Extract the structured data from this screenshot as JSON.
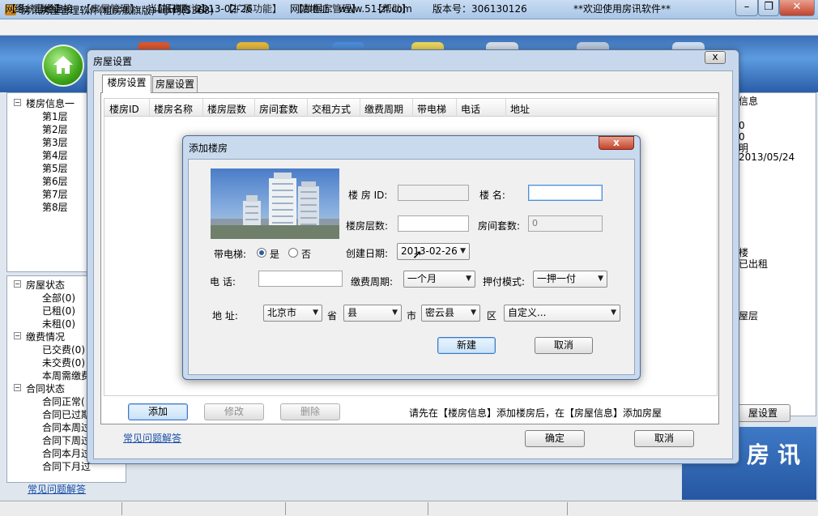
{
  "window": {
    "title": "房讯房屋管理软件(租房舰旗版)--小何(5368)",
    "min": "–",
    "max": "❐",
    "close": "✕"
  },
  "menu": [
    "【系统菜单】",
    "【房屋管理】",
    "【报表查询】",
    "【扩展功能】",
    "【数据库管理】",
    "【帮助】"
  ],
  "left_tree": {
    "root": "楼房信息一",
    "floors": [
      "第1层",
      "第2层",
      "第3层",
      "第4层",
      "第5层",
      "第6层",
      "第7层",
      "第8层"
    ]
  },
  "status_tree": {
    "house_status": "房屋状态",
    "house_items": [
      "全部(0)",
      "已租(0)",
      "未租(0)"
    ],
    "payment": "缴费情况",
    "payment_items": [
      "已交费(0)",
      "未交费(0)",
      "本周需缴费"
    ],
    "contract": "合同状态",
    "contract_items": [
      "合同正常(",
      "合同已过期",
      "合同本周过",
      "合同下周过",
      "合同本月过",
      "合同下月过"
    ]
  },
  "faq_left": "常见问题解答",
  "right_panel": {
    "lines": [
      "信息",
      "0",
      "0",
      "明",
      "2013/05/24",
      "楼",
      "已出租",
      "屋层"
    ],
    "button": "屋设置",
    "brand": "房讯"
  },
  "status_bar": {
    "network": "网络：已经连接",
    "date": "当前日期：2013-02-26",
    "site": "网站地址：www.51-zf.com",
    "version": "版本号：306130126",
    "welcome": "**欢迎使用房讯软件**"
  },
  "house_settings": {
    "title": "房屋设置",
    "close": "x",
    "tabs": [
      "楼房设置",
      "房屋设置"
    ],
    "columns": [
      "楼房ID",
      "楼房名称",
      "楼房层数",
      "房间套数",
      "交租方式",
      "缴费周期",
      "带电梯",
      "电话",
      "地址"
    ],
    "add": "添加",
    "edit": "修改",
    "delete": "删除",
    "hint": "请先在【楼房信息】添加楼房后，在【房屋信息】添加房屋",
    "faq": "常见问题解答",
    "ok": "确定",
    "cancel": "取消"
  },
  "add_building": {
    "title": "添加楼房",
    "close": "x",
    "building_id_label": "楼 房 ID:",
    "building_id": "",
    "name_label": "楼    名:",
    "name": "",
    "floors_label": "楼房层数:",
    "floors": "",
    "rooms_label": "房间套数:",
    "rooms": "0",
    "elevator_label": "带电梯:",
    "elevator_yes": "是",
    "elevator_no": "否",
    "elevator_value": "是",
    "created_label": "创建日期:",
    "created": "2013-02-26",
    "phone_label": "电    话:",
    "phone": "",
    "period_label": "缴费周期:",
    "period": "一个月",
    "payment_label": "押付模式:",
    "payment": "一押一付",
    "address_label": "地    址:",
    "province": "北京市",
    "province_unit": "省",
    "city": "县",
    "city_unit": "市",
    "district": "密云县",
    "district_unit": "区",
    "custom": "自定义...",
    "create": "新建",
    "cancel": "取消"
  },
  "colors": {
    "title_bar": "#a9c6e8",
    "toolbar": "#3b6fb5",
    "dialog_frame": "#c9daee",
    "link": "#1a4fa8"
  }
}
